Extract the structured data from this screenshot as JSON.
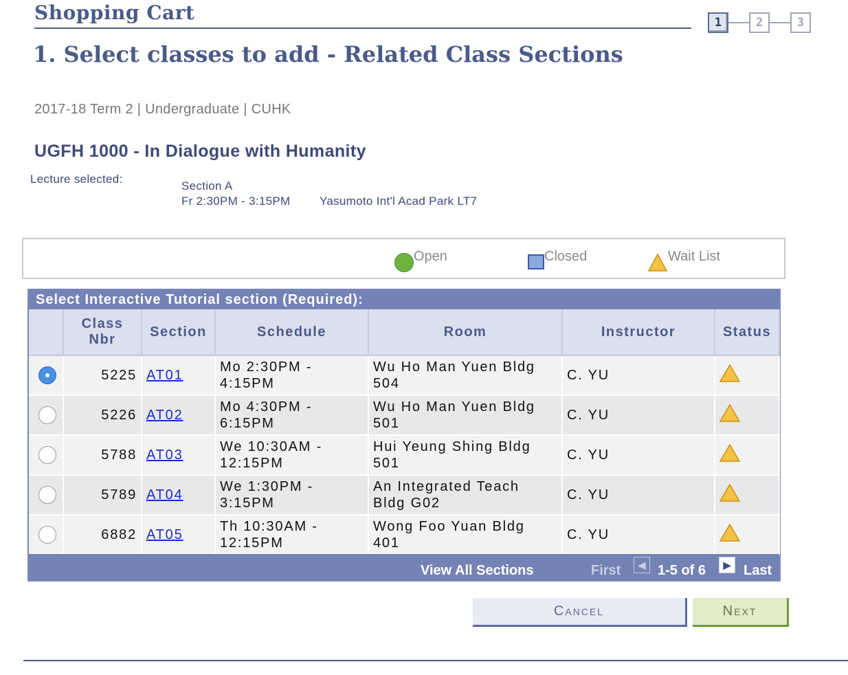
{
  "header": {
    "title": "Shopping Cart",
    "subtitle": "1.  Select classes to add - Related Class Sections",
    "steps": [
      "1",
      "2",
      "3"
    ]
  },
  "term_line": "2017-18 Term 2 | Undergraduate | CUHK",
  "course": {
    "title": "UGFH 1000 - In Dialogue with Humanity",
    "lecture_label": "Lecture selected:",
    "lecture_section": "Section A",
    "lecture_time": "Fr 2:30PM - 3:15PM",
    "lecture_room": "Yasumoto Int'l Acad Park LT7"
  },
  "legend": {
    "open": "Open",
    "closed": "Closed",
    "wait_list": "Wait List"
  },
  "grid": {
    "caption": "Select Interactive Tutorial section (Required):",
    "columns": {
      "class_nbr_1": "Class",
      "class_nbr_2": "Nbr",
      "section": "Section",
      "schedule": "Schedule",
      "room": "Room",
      "instructor": "Instructor",
      "status": "Status"
    },
    "rows": [
      {
        "nbr": "5225",
        "section": "AT01",
        "sched1": "Mo 2:30PM -",
        "sched2": "4:15PM",
        "room1": "Wu Ho Man Yuen Bldg",
        "room2": "504",
        "instructor": "C. YU"
      },
      {
        "nbr": "5226",
        "section": "AT02",
        "sched1": "Mo 4:30PM -",
        "sched2": "6:15PM",
        "room1": "Wu Ho Man Yuen Bldg",
        "room2": "501",
        "instructor": "C. YU"
      },
      {
        "nbr": "5788",
        "section": "AT03",
        "sched1": "We 10:30AM -",
        "sched2": "12:15PM",
        "room1": "Hui Yeung Shing Bldg",
        "room2": "501",
        "instructor": "C. YU"
      },
      {
        "nbr": "5789",
        "section": "AT04",
        "sched1": "We 1:30PM -",
        "sched2": "3:15PM",
        "room1": "An Integrated Teach",
        "room2": "Bldg G02",
        "instructor": "C. YU"
      },
      {
        "nbr": "6882",
        "section": "AT05",
        "sched1": "Th 10:30AM -",
        "sched2": "12:15PM",
        "room1": "Wong Foo Yuan Bldg",
        "room2": "401",
        "instructor": "C. YU"
      }
    ],
    "footer": {
      "view_all": "View All Sections",
      "first": "First",
      "range": "1-5 of 6",
      "last": "Last"
    }
  },
  "buttons": {
    "cancel": "Cancel",
    "next": "Next"
  },
  "colors": {
    "header_text": "#4a5a8a",
    "grid_bar": "#7582b5",
    "open": "#6cb33f",
    "closed": "#8aa8e0",
    "wait_list": "#f5c242"
  }
}
